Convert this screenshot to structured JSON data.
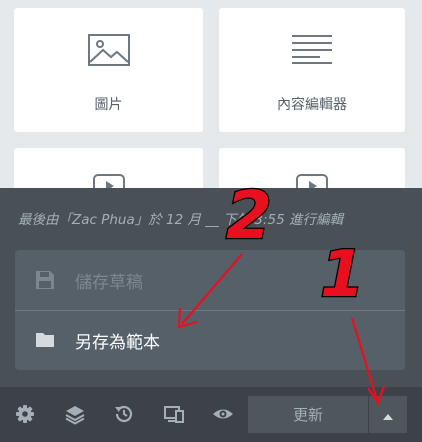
{
  "widgets": [
    {
      "label": "圖片",
      "icon": "image-icon"
    },
    {
      "label": "內容編輯器",
      "icon": "text-editor-icon"
    },
    {
      "label": "",
      "icon": "video-icon"
    },
    {
      "label": "",
      "icon": "video-icon"
    }
  ],
  "panel": {
    "last_edited": "最後由「Zac Phua」於 12 月 __ 下午 3:55 進行編輯",
    "save_options": [
      {
        "label": "儲存草稿",
        "icon": "save-draft-icon",
        "state": "disabled"
      },
      {
        "label": "另存為範本",
        "icon": "folder-icon",
        "state": "enabled"
      }
    ]
  },
  "footer": {
    "icons": [
      "settings-icon",
      "layers-icon",
      "history-icon",
      "responsive-icon",
      "preview-icon"
    ],
    "update_label": "更新",
    "more_icon": "caret-up-icon"
  },
  "annotations": {
    "marker_1": "1",
    "marker_2": "2"
  },
  "colors": {
    "panel_bg": "#495157",
    "footer_bg": "#3c4247",
    "annotation_red": "#e8101f"
  }
}
